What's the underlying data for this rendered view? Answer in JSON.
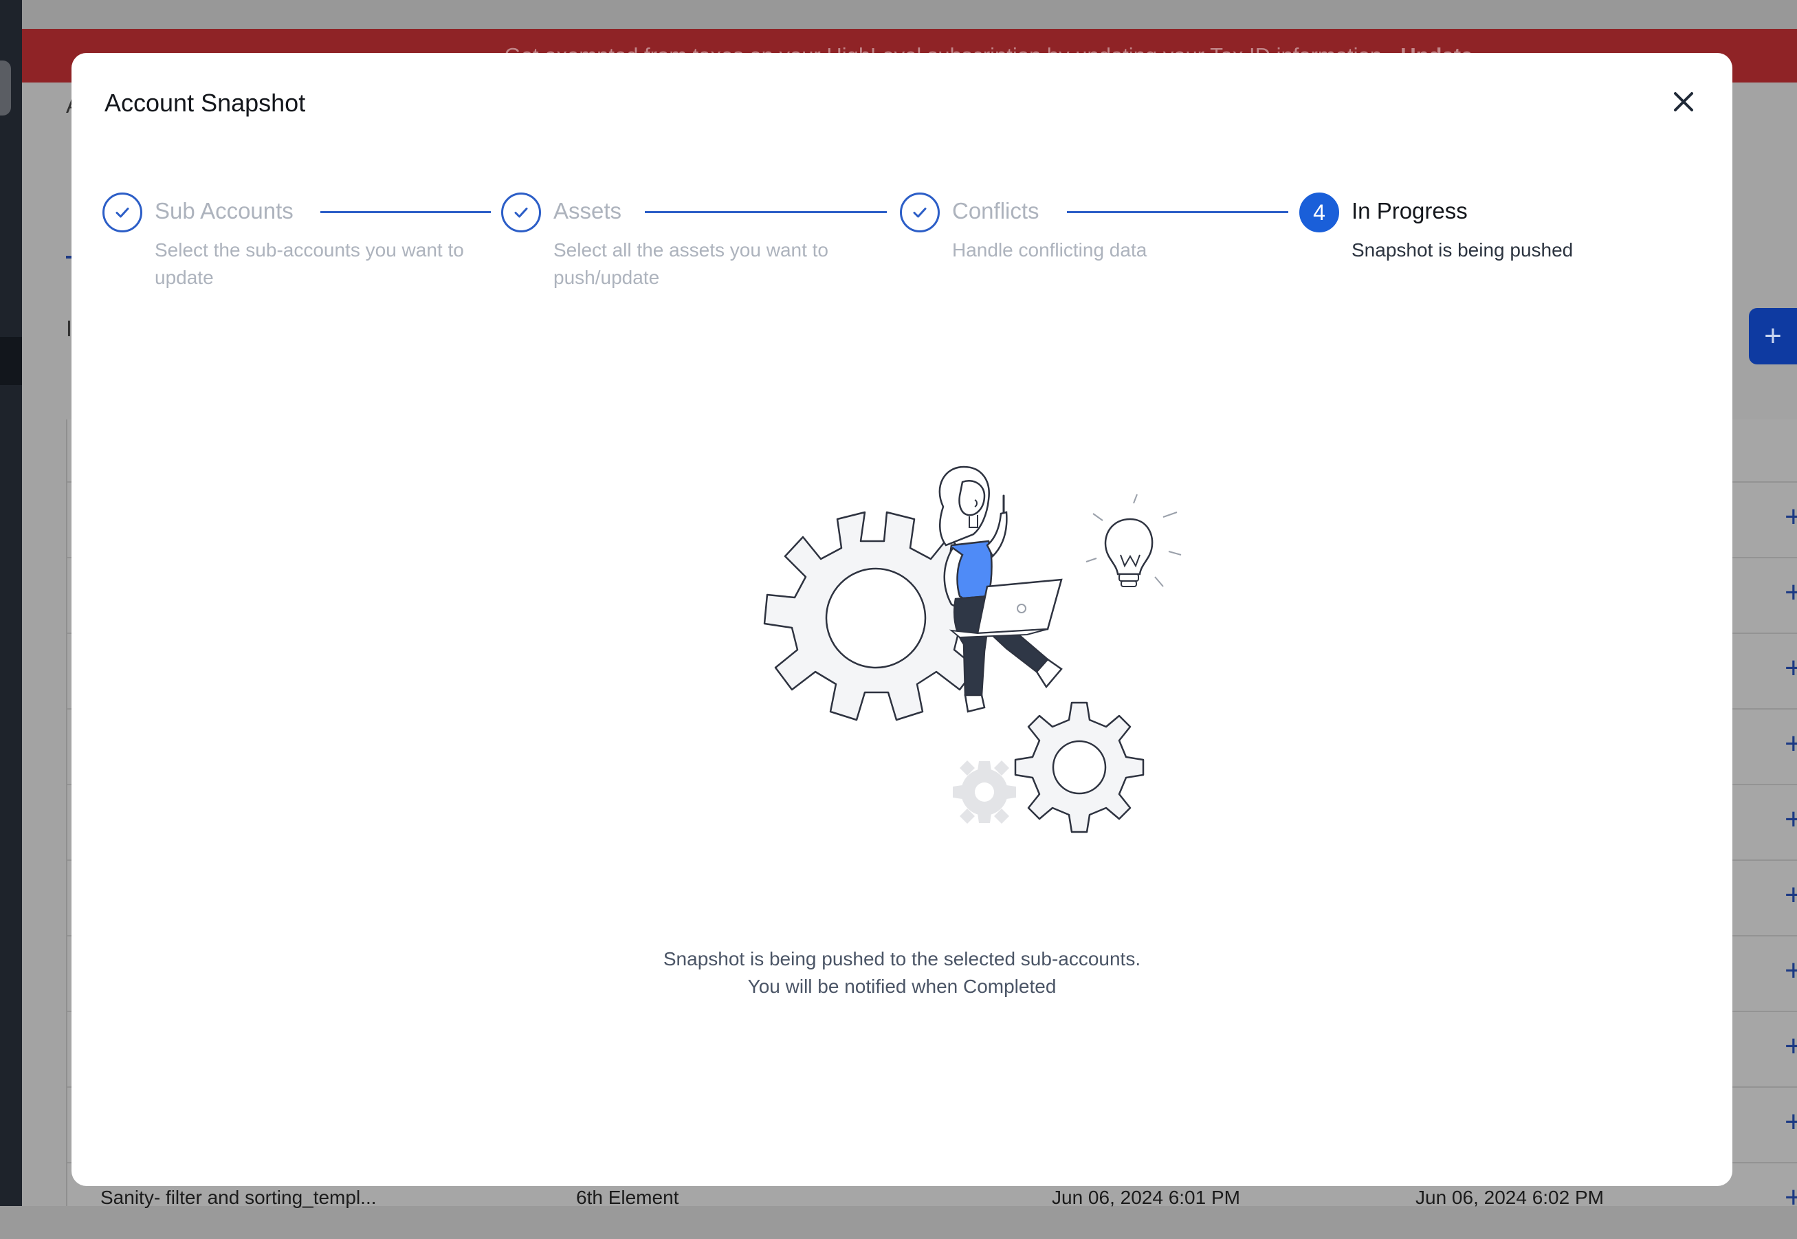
{
  "background": {
    "banner_text": "Get exempted from taxes on your HighLevel subscription by updating your Tax ID information.",
    "banner_link": "Update",
    "bottom_row": {
      "name": "Sanity- filter and sorting_templ...",
      "owner": "6th Element",
      "created": "Jun 06, 2024 6:01 PM",
      "updated": "Jun 06, 2024 6:02 PM"
    }
  },
  "modal": {
    "title": "Account Snapshot",
    "close_icon": "close-icon",
    "steps": [
      {
        "label": "Sub Accounts",
        "description": "Select the sub-accounts you want to update",
        "status": "complete",
        "icon": "check-icon"
      },
      {
        "label": "Assets",
        "description": "Select all the assets you want to push/update",
        "status": "complete",
        "icon": "check-icon"
      },
      {
        "label": "Conflicts",
        "description": "Handle conflicting data",
        "status": "complete",
        "icon": "check-icon"
      },
      {
        "label": "In Progress",
        "description": "Snapshot is being pushed",
        "status": "current",
        "number": "4"
      }
    ],
    "illustration": "person-on-gears-illustration",
    "message_line1": "Snapshot is being pushed to the selected sub-accounts.",
    "message_line2": "You will be notified when Completed"
  },
  "colors": {
    "accent": "#1a5fd9",
    "banner": "#8f2326",
    "illustration_blue": "#4f8bf7"
  }
}
